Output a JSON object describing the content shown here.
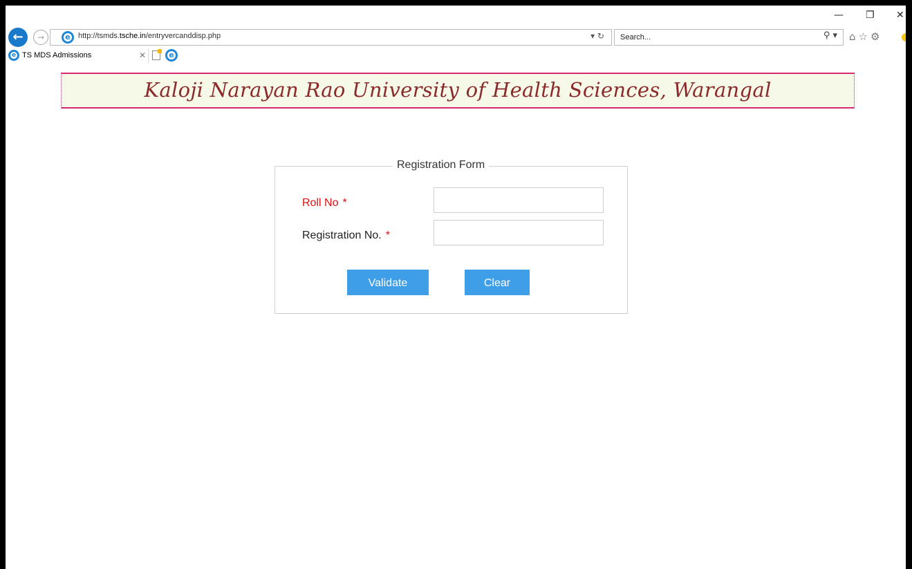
{
  "browser": {
    "url_prefix": "http://tsmds.",
    "url_domain": "tsche.in",
    "url_path": "/entryvercanddisp.php",
    "search_placeholder": "Search...",
    "tab_title": "TS MDS Admissions"
  },
  "page": {
    "banner_title": "Kaloji Narayan Rao University of Health Sciences, Warangal",
    "form": {
      "legend": "Registration Form",
      "rollno_label": "Roll No",
      "rollno_value": "",
      "regno_label": "Registration No.",
      "regno_value": "",
      "required_marker": "*",
      "validate_label": "Validate",
      "clear_label": "Clear"
    }
  },
  "colors": {
    "banner_border": "#d4286f",
    "banner_text": "#8b2a2a",
    "button": "#3f9ee8",
    "required": "#e01010"
  }
}
